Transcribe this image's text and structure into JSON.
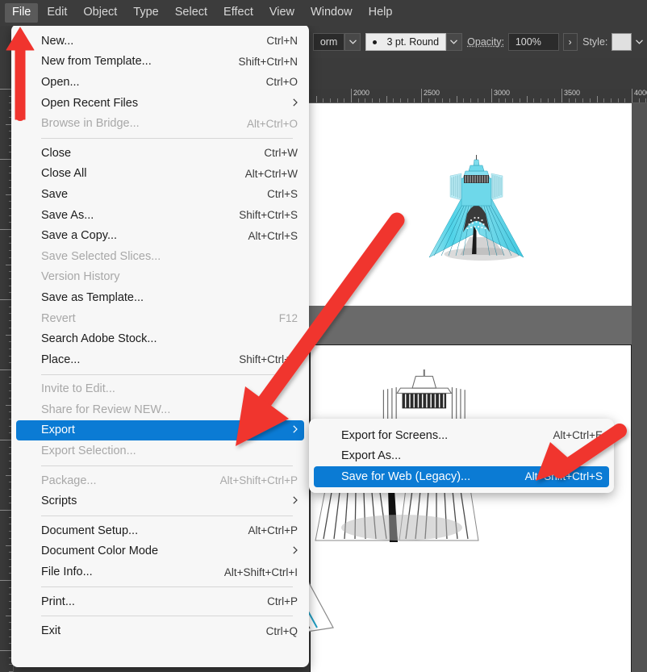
{
  "menubar": {
    "items": [
      {
        "label": "File",
        "active": true
      },
      {
        "label": "Edit",
        "active": false
      },
      {
        "label": "Object",
        "active": false
      },
      {
        "label": "Type",
        "active": false
      },
      {
        "label": "Select",
        "active": false
      },
      {
        "label": "Effect",
        "active": false
      },
      {
        "label": "View",
        "active": false
      },
      {
        "label": "Window",
        "active": false
      },
      {
        "label": "Help",
        "active": false
      }
    ]
  },
  "toolbar": {
    "profile_value": "orm",
    "brush_value": "3 pt. Round",
    "opacity_label": "Opacity:",
    "opacity_value": "100%",
    "style_label": "Style:",
    "more_arrow": "›",
    "caret": "⌄"
  },
  "ruler": {
    "unit_labels": [
      "2000",
      "2500",
      "3000",
      "3500",
      "4000"
    ]
  },
  "file_menu": {
    "items": [
      {
        "label": "New...",
        "accel": "Ctrl+N",
        "disabled": false,
        "submenu": false,
        "highlight": false
      },
      {
        "label": "New from Template...",
        "accel": "Shift+Ctrl+N",
        "disabled": false,
        "submenu": false,
        "highlight": false
      },
      {
        "label": "Open...",
        "accel": "Ctrl+O",
        "disabled": false,
        "submenu": false,
        "highlight": false
      },
      {
        "label": "Open Recent Files",
        "accel": "",
        "disabled": false,
        "submenu": true,
        "highlight": false
      },
      {
        "label": "Browse in Bridge...",
        "accel": "Alt+Ctrl+O",
        "disabled": true,
        "submenu": false,
        "highlight": false
      },
      {
        "separator": true
      },
      {
        "label": "Close",
        "accel": "Ctrl+W",
        "disabled": false,
        "submenu": false,
        "highlight": false
      },
      {
        "label": "Close All",
        "accel": "Alt+Ctrl+W",
        "disabled": false,
        "submenu": false,
        "highlight": false
      },
      {
        "label": "Save",
        "accel": "Ctrl+S",
        "disabled": false,
        "submenu": false,
        "highlight": false
      },
      {
        "label": "Save As...",
        "accel": "Shift+Ctrl+S",
        "disabled": false,
        "submenu": false,
        "highlight": false
      },
      {
        "label": "Save a Copy...",
        "accel": "Alt+Ctrl+S",
        "disabled": false,
        "submenu": false,
        "highlight": false
      },
      {
        "label": "Save Selected Slices...",
        "accel": "",
        "disabled": true,
        "submenu": false,
        "highlight": false
      },
      {
        "label": "Version History",
        "accel": "",
        "disabled": true,
        "submenu": false,
        "highlight": false
      },
      {
        "label": "Save as Template...",
        "accel": "",
        "disabled": false,
        "submenu": false,
        "highlight": false
      },
      {
        "label": "Revert",
        "accel": "F12",
        "disabled": true,
        "submenu": false,
        "highlight": false
      },
      {
        "label": "Search Adobe Stock...",
        "accel": "",
        "disabled": false,
        "submenu": false,
        "highlight": false
      },
      {
        "label": "Place...",
        "accel": "Shift+Ctrl+P",
        "disabled": false,
        "submenu": false,
        "highlight": false
      },
      {
        "separator": true
      },
      {
        "label": "Invite to Edit...",
        "accel": "",
        "disabled": true,
        "submenu": false,
        "highlight": false
      },
      {
        "label": "Share for Review NEW...",
        "accel": "",
        "disabled": true,
        "submenu": false,
        "highlight": false
      },
      {
        "label": "Export",
        "accel": "",
        "disabled": false,
        "submenu": true,
        "highlight": true
      },
      {
        "label": "Export Selection...",
        "accel": "",
        "disabled": true,
        "submenu": false,
        "highlight": false
      },
      {
        "separator": true
      },
      {
        "label": "Package...",
        "accel": "Alt+Shift+Ctrl+P",
        "disabled": true,
        "submenu": false,
        "highlight": false
      },
      {
        "label": "Scripts",
        "accel": "",
        "disabled": false,
        "submenu": true,
        "highlight": false
      },
      {
        "separator": true
      },
      {
        "label": "Document Setup...",
        "accel": "Alt+Ctrl+P",
        "disabled": false,
        "submenu": false,
        "highlight": false
      },
      {
        "label": "Document Color Mode",
        "accel": "",
        "disabled": false,
        "submenu": true,
        "highlight": false
      },
      {
        "label": "File Info...",
        "accel": "Alt+Shift+Ctrl+I",
        "disabled": false,
        "submenu": false,
        "highlight": false
      },
      {
        "separator": true
      },
      {
        "label": "Print...",
        "accel": "Ctrl+P",
        "disabled": false,
        "submenu": false,
        "highlight": false
      },
      {
        "separator": true
      },
      {
        "label": "Exit",
        "accel": "Ctrl+Q",
        "disabled": false,
        "submenu": false,
        "highlight": false
      }
    ]
  },
  "export_submenu": {
    "items": [
      {
        "label": "Export for Screens...",
        "accel": "Alt+Ctrl+E",
        "disabled": false,
        "highlight": false
      },
      {
        "label": "Export As...",
        "accel": "",
        "disabled": false,
        "highlight": false
      },
      {
        "label": "Save for Web (Legacy)...",
        "accel": "Alt+Shift+Ctrl+S",
        "disabled": false,
        "highlight": true
      }
    ]
  },
  "colors": {
    "highlight_blue": "#0b7bd4",
    "annotation_red": "#f0342e",
    "menu_bg": "#f7f7f7",
    "chrome_bg": "#3c3c3c",
    "artwork_cyan": "#5ad4e6"
  },
  "annotations": {
    "arrow_to_file_menu": "arrow-up-red",
    "arrow_to_export": "arrow-diagonal-red",
    "arrow_to_save_for_web": "arrow-diagonal-red"
  }
}
